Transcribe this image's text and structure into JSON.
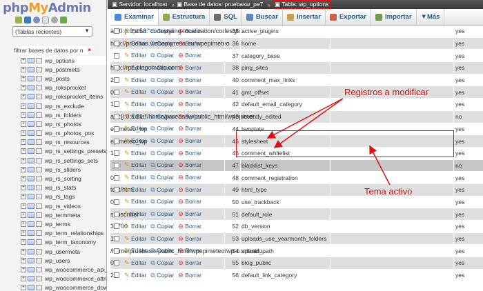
{
  "logo": {
    "php": "php",
    "my": "My",
    "admin": "Admin"
  },
  "sidebar": {
    "recent_select": "(Tablas recientes)",
    "filter_text": "filtrar bases de datos por n",
    "tables": [
      "wp_options",
      "wp_postmeta",
      "wp_posts",
      "wp_roksprocket",
      "wp_roksprocket_items",
      "wp_rs_exclude",
      "wp_rs_folders",
      "wp_rs_photos",
      "wp_rs_photos_pos",
      "wp_rs_resources",
      "wp_rs_settings_presets",
      "wp_rs_settings_sets",
      "wp_rs_sliders",
      "wp_rs_sorting",
      "wp_rs_stats",
      "wp_rs_tags",
      "wp_rs_videos",
      "wp_termmeta",
      "wp_terms",
      "wp_term_relationships",
      "wp_term_taxonomy",
      "wp_usermeta",
      "wp_users",
      "wp_woocommerce_api_k",
      "wp_woocommerce_attrib",
      "wp_woocommerce_down",
      "wp_woocommerce_order"
    ]
  },
  "breadcrumb": {
    "server": "Servidor: localhost",
    "database": "Base de datos: pruebasw_pe7",
    "table": "Tabla: wp_options"
  },
  "tabs": [
    "Examinar",
    "Estructura",
    "SQL",
    "Buscar",
    "Insertar",
    "Exportar",
    "Importar",
    "Más"
  ],
  "row_actions": {
    "edit": "Editar",
    "copy": "Copiar",
    "delete": "Borrar"
  },
  "rows": [
    {
      "id": "35",
      "name": "active_plugins",
      "value": "a:30:{i:0;s:53:\"codestyling-localization/codestyli...",
      "autoload": "yes"
    },
    {
      "id": "36",
      "name": "home",
      "value": "http://pruebas.webempresa.eu/wpepimeteo",
      "autoload": "yes"
    },
    {
      "id": "37",
      "name": "category_base",
      "value": "",
      "autoload": "yes"
    },
    {
      "id": "38",
      "name": "ping_sites",
      "value": "http://rpc.pingomatic.com/",
      "autoload": "yes"
    },
    {
      "id": "40",
      "name": "comment_max_links",
      "value": "2",
      "autoload": "yes"
    },
    {
      "id": "41",
      "name": "gmt_offset",
      "value": "0",
      "autoload": "yes"
    },
    {
      "id": "42",
      "name": "default_email_category",
      "value": "1",
      "autoload": "yes"
    },
    {
      "id": "43",
      "name": "recently_edited",
      "value": "a:5:{i:0;s:81:\"/home/pruebasw/public_html/wpepimet...",
      "autoload": "no"
    },
    {
      "id": "44",
      "name": "template",
      "value": "epimeteo_wp",
      "autoload": "yes"
    },
    {
      "id": "45",
      "name": "stylesheet",
      "value": "epimeteo_wp",
      "autoload": "yes"
    },
    {
      "id": "46",
      "name": "comment_whitelist",
      "value": "1",
      "autoload": "yes"
    },
    {
      "id": "47",
      "name": "blacklist_keys",
      "value": "",
      "autoload": "no"
    },
    {
      "id": "48",
      "name": "comment_registration",
      "value": "0",
      "autoload": "yes"
    },
    {
      "id": "49",
      "name": "html_type",
      "value": "text/html",
      "autoload": "yes"
    },
    {
      "id": "50",
      "name": "use_trackback",
      "value": "0",
      "autoload": "yes"
    },
    {
      "id": "51",
      "name": "default_role",
      "value": "subscriber",
      "autoload": "yes"
    },
    {
      "id": "52",
      "name": "db_version",
      "value": "35700",
      "autoload": "yes"
    },
    {
      "id": "53",
      "name": "uploads_use_yearmonth_folders",
      "value": "1",
      "autoload": "yes"
    },
    {
      "id": "54",
      "name": "upload_path",
      "value": "/home/pruebasw/public_html/wpepimeteo/wp-content/u...",
      "autoload": "yes"
    },
    {
      "id": "55",
      "name": "blog_public",
      "value": "0",
      "autoload": "yes"
    },
    {
      "id": "56",
      "name": "default_link_category",
      "value": "2",
      "autoload": "yes"
    }
  ],
  "annotations": {
    "modify": "Registros a modificar",
    "active_theme": "Tema activo"
  },
  "colors": {
    "accent": "#235a81",
    "highlight": "#e01010"
  }
}
